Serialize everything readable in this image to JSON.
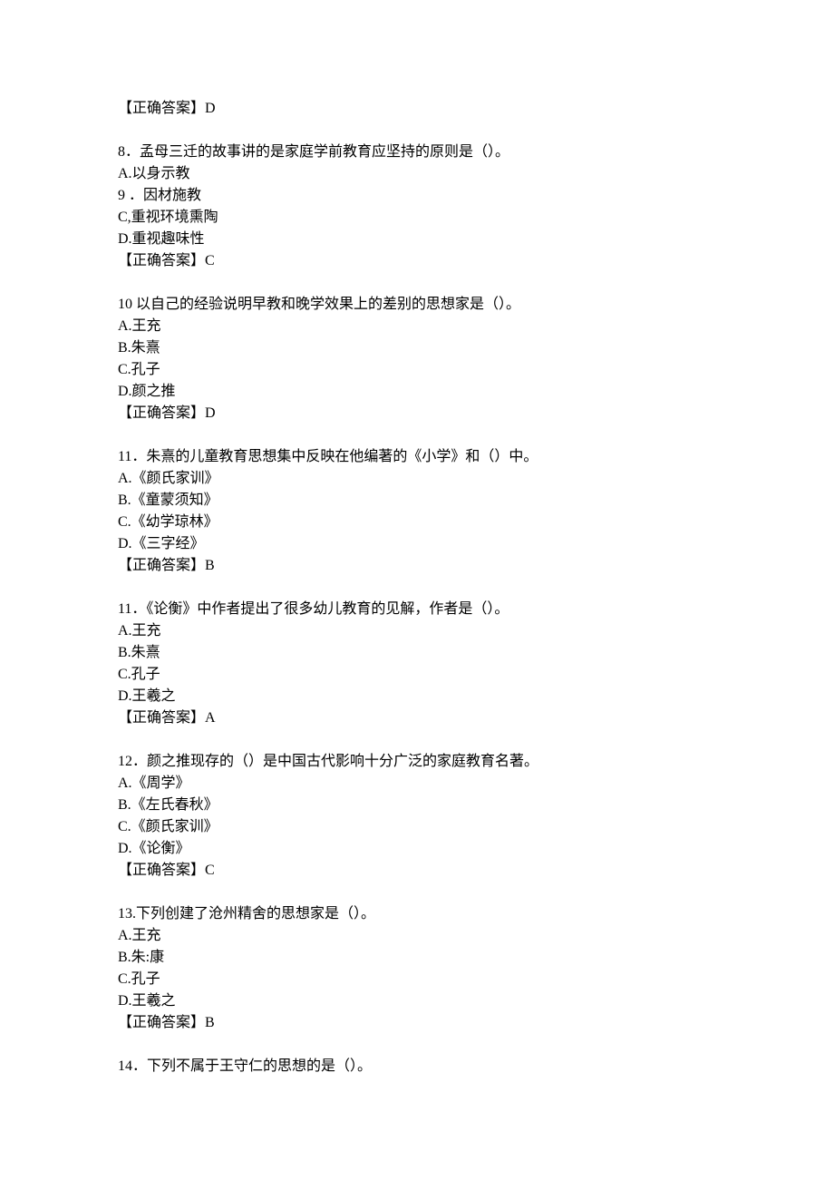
{
  "leading_answer": "【正确答案】D",
  "questions": [
    {
      "num": "8",
      "stem": "．孟母三迁的故事讲的是家庭学前教育应坚持的原则是（）。",
      "options": [
        "A.以身示教",
        "9 ．因材施教",
        "C,重视环境熏陶",
        "D.重视趣味性"
      ],
      "answer": "【正确答案】C"
    },
    {
      "num": "10",
      "stem": "  以自己的经验说明早教和晚学效果上的差别的思想家是（）。",
      "options": [
        "A.王充",
        "B.朱熹",
        "C.孔子",
        "D.颜之推"
      ],
      "answer": "【正确答案】D"
    },
    {
      "num": "11",
      "stem": "．朱熹的儿童教育思想集中反映在他编著的《小学》和（）中。",
      "options": [
        "A.《颜氏家训》",
        "B.《童蒙须知》",
        "C.《幼学琼林》",
        "D.《三字经》"
      ],
      "answer": "【正确答案】B"
    },
    {
      "num": "11",
      "stem": "．《论衡》中作者提出了很多幼儿教育的见解，作者是（）。",
      "options": [
        "A.王充",
        "B.朱熹",
        "C.孔子",
        "D.王羲之"
      ],
      "answer": "【正确答案】A"
    },
    {
      "num": "12",
      "stem": "．颜之推现存的（）是中国古代影响十分广泛的家庭教育名著。",
      "options": [
        "A.《周学》",
        "B.《左氏春秋》",
        "C.《颜氏家训》",
        "D.《论衡》"
      ],
      "answer": "【正确答案】C"
    },
    {
      "num": "13.",
      "stem": "下列创建了沧州精舍的思想家是（）。",
      "options": [
        "A.王充",
        "B.朱:康",
        "C.孔子",
        "D.王羲之"
      ],
      "answer": "【正确答案】B"
    },
    {
      "num": "14",
      "stem": "．下列不属于王守仁的思想的是（）。",
      "options": [],
      "answer": ""
    }
  ]
}
